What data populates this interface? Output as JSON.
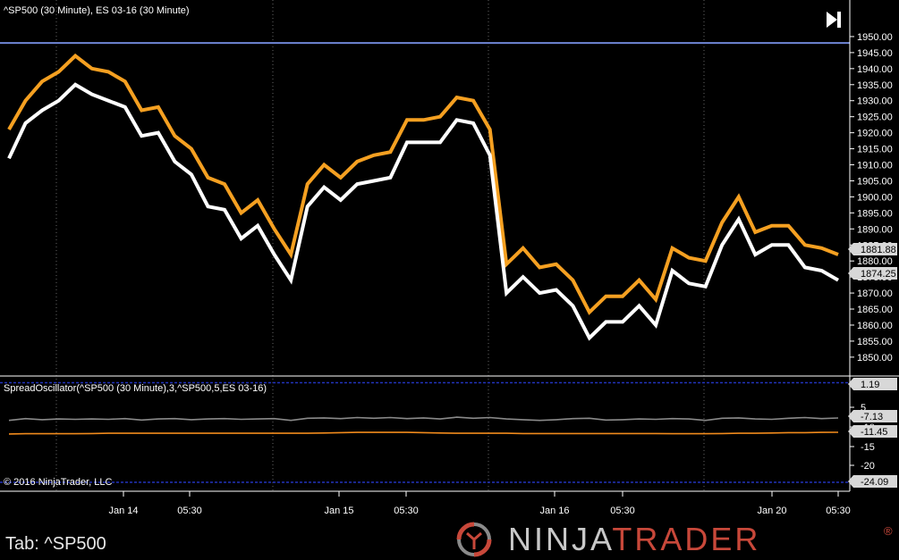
{
  "price_panel": {
    "title": "^SP500 (30 Minute), ES 03-16 (30 Minute)",
    "last_es": "1881.88",
    "last_sp": "1874.25"
  },
  "oscillator_panel": {
    "title": "SpreadOscillator(^SP500 (30 Minute),3,^SP500,5,ES 03-16)",
    "copyright": "© 2016 NinjaTrader, LLC",
    "value_top": "1.19",
    "value_gray": "-7.13",
    "value_orange": "-11.45",
    "value_bottom": "-24.09"
  },
  "x_axis_labels": [
    "Jan 14",
    "05:30",
    "Jan 15",
    "05:30",
    "Jan 16",
    "05:30",
    "Jan 20",
    "05:30"
  ],
  "footer": {
    "tab_label": "Tab: ^SP500",
    "logo_ninja": "NINJA",
    "logo_trader": "TRADER",
    "logo_reg": "®"
  },
  "colors": {
    "background": "#000000",
    "es_series": "#f5a021",
    "sp_series": "#ffffff",
    "reference_line": "#6f86d6",
    "osc_gray": "#8a8a8a",
    "osc_orange": "#f08a1c",
    "osc_band": "#2233bb",
    "logo_red": "#c8483a"
  },
  "chart_data": [
    {
      "type": "line",
      "title": "^SP500 (30 Minute), ES 03-16 (30 Minute)",
      "ylim": [
        1843,
        1955
      ],
      "yticks": [
        1850,
        1855,
        1860,
        1865,
        1870,
        1875,
        1880,
        1885,
        1890,
        1895,
        1900,
        1905,
        1910,
        1915,
        1920,
        1925,
        1930,
        1935,
        1940,
        1945,
        1950
      ],
      "horizontal_line": 1948,
      "x": [
        0,
        1,
        2,
        3,
        4,
        5,
        6,
        7,
        8,
        9,
        10,
        11,
        12,
        13,
        14,
        15,
        16,
        17,
        18,
        19,
        20,
        21,
        22,
        23,
        24,
        25,
        26,
        27,
        28,
        29,
        30,
        31,
        32,
        33,
        34,
        35,
        36,
        37,
        38,
        39,
        40,
        41,
        42,
        43,
        44,
        45,
        46,
        47,
        48,
        49,
        50,
        51,
        52,
        53,
        54,
        55,
        56,
        57,
        58,
        59
      ],
      "series": [
        {
          "name": "ES 03-16",
          "values": [
            1921,
            1930,
            1936,
            1939,
            1944,
            1940,
            1939,
            1936,
            1927,
            1928,
            1919,
            1915,
            1906,
            1904,
            1895,
            1899,
            1890,
            1882,
            1904,
            1910,
            1906,
            1911,
            1913,
            1914,
            1924,
            1924,
            1925,
            1931,
            1930,
            1921,
            1879,
            1884,
            1878,
            1879,
            1874,
            1864,
            1869,
            1869,
            1874,
            1868,
            1884,
            1881,
            1880,
            1892,
            1900,
            1889,
            1891,
            1891,
            1885,
            1884,
            1882
          ]
        },
        {
          "name": "^SP500",
          "values": [
            1912,
            1923,
            1927,
            1930,
            1935,
            1932,
            1930,
            1928,
            1919,
            1920,
            1911,
            1907,
            1897,
            1896,
            1887,
            1891,
            1882,
            1874,
            1897,
            1903,
            1899,
            1904,
            1905,
            1906,
            1917,
            1917,
            1917,
            1924,
            1923,
            1913,
            1870,
            1875,
            1870,
            1871,
            1866,
            1856,
            1861,
            1861,
            1866,
            1860,
            1877,
            1873,
            1872,
            1885,
            1893,
            1882,
            1885,
            1885,
            1878,
            1877,
            1874
          ]
        }
      ]
    },
    {
      "type": "line",
      "title": "SpreadOscillator(^SP500 (30 Minute),3,^SP500,5,ES 03-16)",
      "ylim": [
        -26,
        3
      ],
      "yticks": [
        5,
        -5,
        -10,
        -15,
        -20
      ],
      "bands": [
        1.19,
        -24.09
      ],
      "series": [
        {
          "name": "gray",
          "values": [
            -7.8,
            -7.3,
            -7.6,
            -7.4,
            -7.5,
            -7.4,
            -7.5,
            -7.3,
            -7.7,
            -7.4,
            -7.3,
            -7.6,
            -7.4,
            -7.3,
            -7.5,
            -7.4,
            -7.3,
            -7.8,
            -7.2,
            -7.1,
            -7.3,
            -7.0,
            -7.2,
            -7.0,
            -7.3,
            -7.1,
            -7.4,
            -6.9,
            -7.2,
            -7.0,
            -7.4,
            -7.6,
            -7.8,
            -7.6,
            -7.3,
            -7.2,
            -7.7,
            -7.6,
            -7.4,
            -7.5,
            -7.3,
            -7.4,
            -7.8,
            -7.2,
            -7.1,
            -7.4,
            -7.5,
            -7.2,
            -7.0,
            -7.3,
            -7.13
          ]
        },
        {
          "name": "orange",
          "values": [
            -12.1,
            -12.0,
            -12.0,
            -12.0,
            -12.0,
            -11.9,
            -11.8,
            -11.8,
            -11.8,
            -11.8,
            -11.8,
            -11.8,
            -11.8,
            -11.8,
            -11.8,
            -11.8,
            -11.8,
            -11.8,
            -11.8,
            -11.7,
            -11.6,
            -11.5,
            -11.5,
            -11.5,
            -11.5,
            -11.6,
            -11.7,
            -11.8,
            -11.8,
            -11.8,
            -11.8,
            -11.9,
            -11.9,
            -11.9,
            -11.9,
            -11.9,
            -11.9,
            -11.9,
            -11.9,
            -11.9,
            -12.0,
            -12.0,
            -12.0,
            -11.9,
            -11.8,
            -11.8,
            -11.7,
            -11.6,
            -11.6,
            -11.5,
            -11.45
          ]
        }
      ]
    }
  ]
}
